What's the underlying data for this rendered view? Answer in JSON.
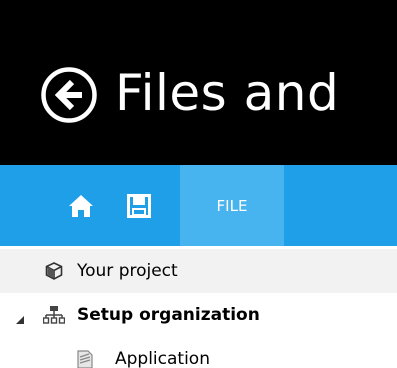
{
  "header": {
    "title": "Files and",
    "back_icon": "arrow-left-circle-icon",
    "background": "#000000"
  },
  "toolbar": {
    "background": "#1f9fe8",
    "home_icon": "home-icon",
    "save_icon": "save-disk-icon",
    "file_tab_label": "FILE",
    "file_tab_active_color": "#47b3ef"
  },
  "tree": {
    "items": [
      {
        "label": "Your project",
        "icon": "project-cube-icon",
        "selected": true
      },
      {
        "label": "Setup organization",
        "icon": "org-hierarchy-icon",
        "expanded": true
      },
      {
        "label": "Application",
        "icon": "document-icon"
      }
    ]
  }
}
